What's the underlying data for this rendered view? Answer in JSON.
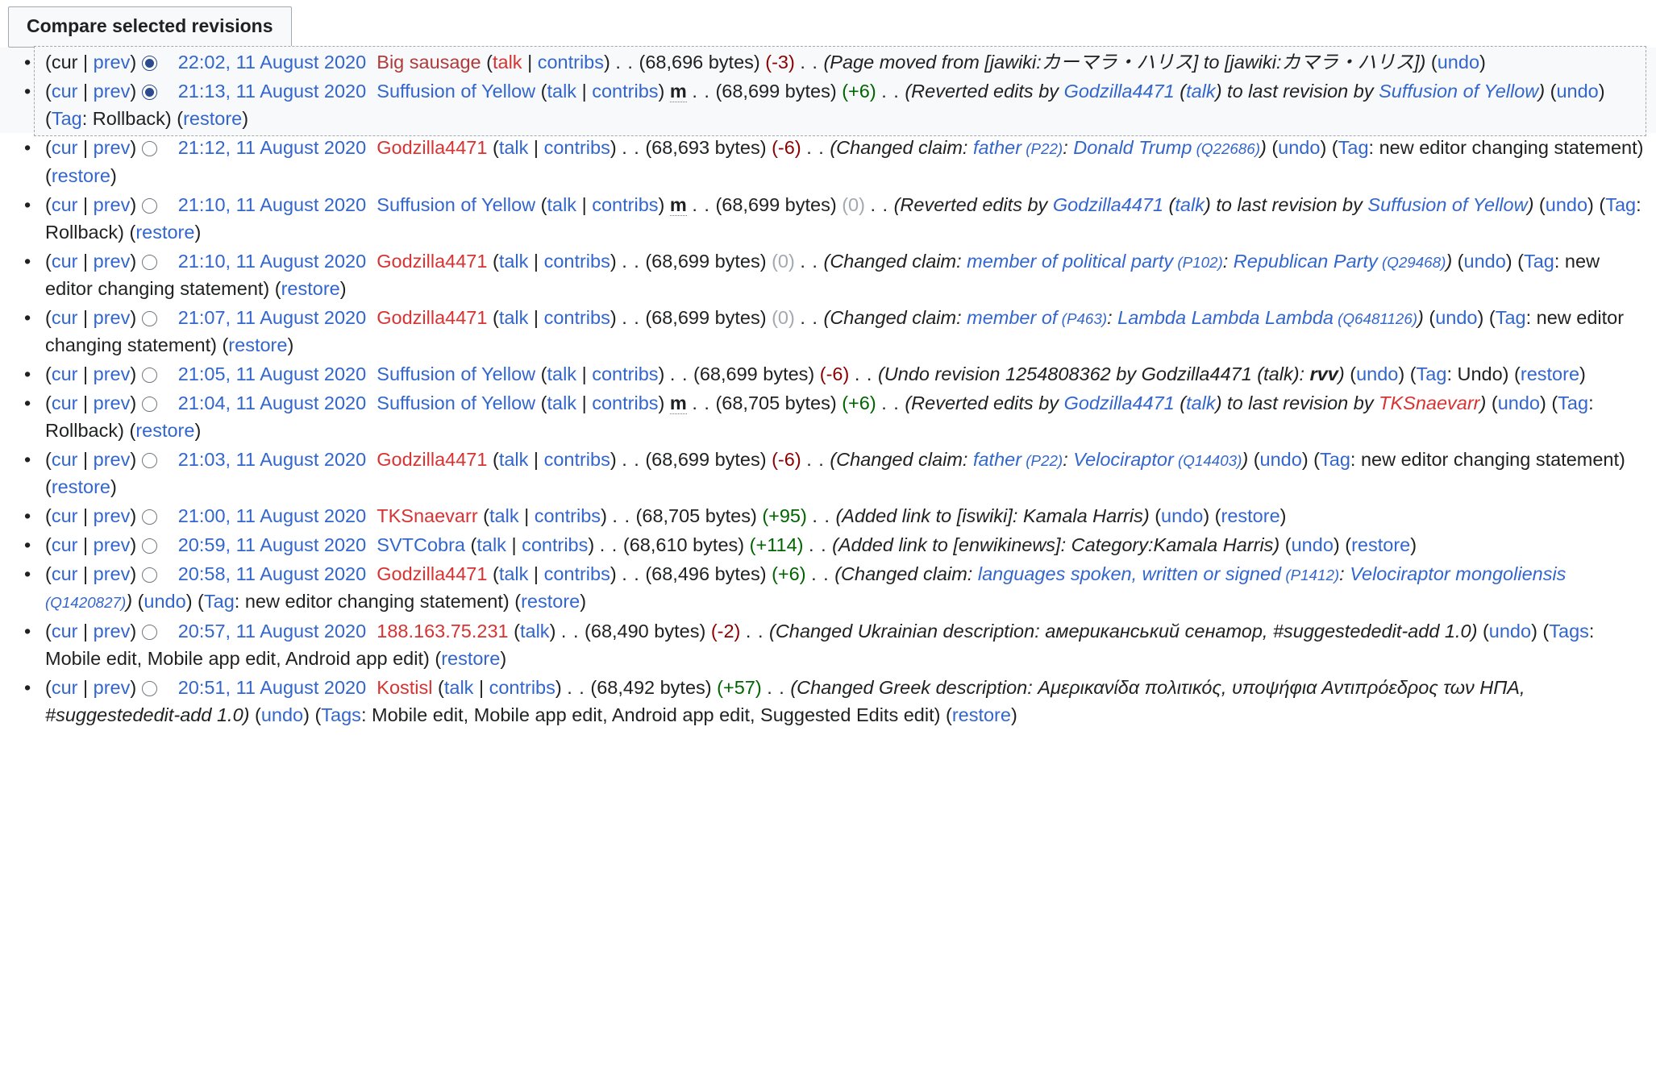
{
  "toolbar": {
    "compare_label": "Compare selected revisions"
  },
  "labels": {
    "cur": "cur",
    "prev": "prev",
    "pipe": "|",
    "talk": "talk",
    "contribs": "contribs",
    "undo": "undo",
    "restore": "restore",
    "minor": "m",
    "dots": ". .",
    "tag_word": "Tag",
    "tags_word": "Tags",
    "bytes_word": "bytes"
  },
  "colors": {
    "link": "#3366cc",
    "link_red": "#d73333",
    "link_red_visited": "#b03a3a",
    "diff_positive": "#006400",
    "diff_negative": "#8b0000",
    "diff_zero": "#a2a9b1",
    "comment": "#72777d",
    "selected_bg": "#f8f9fa",
    "border": "#a2a9b1"
  },
  "revisions": [
    {
      "selected": true,
      "radio": "on",
      "time": "22:02, 11 August 2020",
      "user": "Big sausage",
      "user_color": "red-visited",
      "minor": false,
      "size": "(68,696 bytes)",
      "delta": "(-3)",
      "delta_kind": "neg",
      "comment_prefix": "Page moved from [jawiki:",
      "comment_text": "(Page moved from [jawiki:カーマラ・ハリス] to [jawiki:カマラ・ハリス])",
      "has_undo": true,
      "tags": null,
      "has_restore": false
    },
    {
      "selected": true,
      "radio": "on",
      "time": "21:13, 11 August 2020",
      "user": "Suffusion of Yellow",
      "user_color": "blue",
      "minor": true,
      "size": "(68,699 bytes)",
      "delta": "(+6)",
      "delta_kind": "pos",
      "comment_text": "(Reverted edits by Godzilla4471 (talk) to last revision by Suffusion of Yellow)",
      "comment_parts": [
        {
          "t": "(Reverted edits by ",
          "k": "plain"
        },
        {
          "t": "Godzilla4471",
          "k": "link"
        },
        {
          "t": " (",
          "k": "plain"
        },
        {
          "t": "talk",
          "k": "link"
        },
        {
          "t": ") to last revision by ",
          "k": "plain"
        },
        {
          "t": "Suffusion of Yellow",
          "k": "link"
        },
        {
          "t": ")",
          "k": "plain"
        }
      ],
      "has_undo": true,
      "tags": "Rollback",
      "tag_label": "Tag",
      "has_restore": true
    },
    {
      "selected": false,
      "radio": "off",
      "time": "21:12, 11 August 2020",
      "user": "Godzilla4471",
      "user_color": "red",
      "minor": false,
      "size": "(68,693 bytes)",
      "delta": "(-6)",
      "delta_kind": "neg",
      "comment_parts": [
        {
          "t": "(Changed claim: ",
          "k": "plain"
        },
        {
          "t": "father",
          "k": "link"
        },
        {
          "t": " (P22)",
          "k": "link-small"
        },
        {
          "t": ": ",
          "k": "plain"
        },
        {
          "t": "Donald Trump",
          "k": "link"
        },
        {
          "t": " (Q22686)",
          "k": "link-small"
        },
        {
          "t": ")",
          "k": "plain"
        }
      ],
      "has_undo": true,
      "tags": "new editor changing statement",
      "tag_label": "Tag",
      "has_restore": true
    },
    {
      "selected": false,
      "radio": "off",
      "time": "21:10, 11 August 2020",
      "user": "Suffusion of Yellow",
      "user_color": "blue",
      "minor": true,
      "size": "(68,699 bytes)",
      "delta": "(0)",
      "delta_kind": "zero",
      "comment_parts": [
        {
          "t": "(Reverted edits by ",
          "k": "plain"
        },
        {
          "t": "Godzilla4471",
          "k": "link"
        },
        {
          "t": " (",
          "k": "plain"
        },
        {
          "t": "talk",
          "k": "link"
        },
        {
          "t": ") to last revision by ",
          "k": "plain"
        },
        {
          "t": "Suffusion of Yellow",
          "k": "link"
        },
        {
          "t": ")",
          "k": "plain"
        }
      ],
      "has_undo": true,
      "tags": "Rollback",
      "tag_label": "Tag",
      "has_restore": true
    },
    {
      "selected": false,
      "radio": "off",
      "time": "21:10, 11 August 2020",
      "user": "Godzilla4471",
      "user_color": "red",
      "minor": false,
      "size": "(68,699 bytes)",
      "delta": "(0)",
      "delta_kind": "zero",
      "comment_parts": [
        {
          "t": "(Changed claim: ",
          "k": "plain"
        },
        {
          "t": "member of political party",
          "k": "link"
        },
        {
          "t": " (P102)",
          "k": "link-small"
        },
        {
          "t": ": ",
          "k": "plain"
        },
        {
          "t": "Republican Party",
          "k": "link"
        },
        {
          "t": " (Q29468)",
          "k": "link-small"
        },
        {
          "t": ")",
          "k": "plain"
        }
      ],
      "has_undo": true,
      "tags": "new editor changing statement",
      "tag_label": "Tag",
      "has_restore": true
    },
    {
      "selected": false,
      "radio": "off",
      "time": "21:07, 11 August 2020",
      "user": "Godzilla4471",
      "user_color": "red",
      "minor": false,
      "size": "(68,699 bytes)",
      "delta": "(0)",
      "delta_kind": "zero",
      "comment_parts": [
        {
          "t": "(Changed claim: ",
          "k": "plain"
        },
        {
          "t": "member of",
          "k": "link"
        },
        {
          "t": " (P463)",
          "k": "link-small"
        },
        {
          "t": ": ",
          "k": "plain"
        },
        {
          "t": "Lambda Lambda Lambda",
          "k": "link"
        },
        {
          "t": " (Q6481126)",
          "k": "link-small"
        },
        {
          "t": ")",
          "k": "plain"
        }
      ],
      "has_undo": true,
      "tags": "new editor changing statement",
      "tag_label": "Tag",
      "has_restore": true
    },
    {
      "selected": false,
      "radio": "off",
      "time": "21:05, 11 August 2020",
      "user": "Suffusion of Yellow",
      "user_color": "blue",
      "minor": false,
      "size": "(68,699 bytes)",
      "delta": "(-6)",
      "delta_kind": "neg",
      "comment_parts": [
        {
          "t": "(Undo revision 1254808362 by Godzilla4471 (talk): ",
          "k": "plain"
        },
        {
          "t": "rvv",
          "k": "plain-bold-italic"
        },
        {
          "t": ")",
          "k": "plain"
        }
      ],
      "has_undo": true,
      "tags": "Undo",
      "tag_label": "Tag",
      "has_restore": true
    },
    {
      "selected": false,
      "radio": "off",
      "time": "21:04, 11 August 2020",
      "user": "Suffusion of Yellow",
      "user_color": "blue",
      "minor": true,
      "size": "(68,705 bytes)",
      "delta": "(+6)",
      "delta_kind": "pos",
      "comment_parts": [
        {
          "t": "(Reverted edits by ",
          "k": "plain"
        },
        {
          "t": "Godzilla4471",
          "k": "link"
        },
        {
          "t": " (",
          "k": "plain"
        },
        {
          "t": "talk",
          "k": "link"
        },
        {
          "t": ") to last revision by ",
          "k": "plain"
        },
        {
          "t": "TKSnaevarr",
          "k": "link-red"
        },
        {
          "t": ")",
          "k": "plain"
        }
      ],
      "has_undo": true,
      "tags": "Rollback",
      "tag_label": "Tag",
      "has_restore": true
    },
    {
      "selected": false,
      "radio": "off",
      "time": "21:03, 11 August 2020",
      "user": "Godzilla4471",
      "user_color": "red",
      "minor": false,
      "size": "(68,699 bytes)",
      "delta": "(-6)",
      "delta_kind": "neg",
      "comment_parts": [
        {
          "t": "(Changed claim: ",
          "k": "plain"
        },
        {
          "t": "father",
          "k": "link"
        },
        {
          "t": " (P22)",
          "k": "link-small"
        },
        {
          "t": ": ",
          "k": "plain"
        },
        {
          "t": "Velociraptor",
          "k": "link"
        },
        {
          "t": " (Q14403)",
          "k": "link-small"
        },
        {
          "t": ")",
          "k": "plain"
        }
      ],
      "has_undo": true,
      "tags": "new editor changing statement",
      "tag_label": "Tag",
      "has_restore": true
    },
    {
      "selected": false,
      "radio": "off",
      "time": "21:00, 11 August 2020",
      "user": "TKSnaevarr",
      "user_color": "red",
      "minor": false,
      "size": "(68,705 bytes)",
      "delta": "(+95)",
      "delta_kind": "pos",
      "comment_parts": [
        {
          "t": "(Added link to [iswiki]: ",
          "k": "plain"
        },
        {
          "t": "Kamala Harris",
          "k": "plain"
        },
        {
          "t": ")",
          "k": "plain"
        }
      ],
      "has_undo": true,
      "tags": null,
      "has_restore": true
    },
    {
      "selected": false,
      "radio": "off",
      "time": "20:59, 11 August 2020",
      "user": "SVTCobra",
      "user_color": "blue",
      "minor": false,
      "size": "(68,610 bytes)",
      "delta": "(+114)",
      "delta_kind": "pos",
      "comment_parts": [
        {
          "t": "(Added link to [enwikinews]: ",
          "k": "plain"
        },
        {
          "t": "Category:Kamala Harris",
          "k": "plain"
        },
        {
          "t": ")",
          "k": "plain"
        }
      ],
      "has_undo": true,
      "tags": null,
      "has_restore": true
    },
    {
      "selected": false,
      "radio": "off",
      "time": "20:58, 11 August 2020",
      "user": "Godzilla4471",
      "user_color": "red",
      "minor": false,
      "size": "(68,496 bytes)",
      "delta": "(+6)",
      "delta_kind": "pos",
      "comment_parts": [
        {
          "t": "(Changed claim: ",
          "k": "plain"
        },
        {
          "t": "languages spoken, written or signed",
          "k": "link"
        },
        {
          "t": " (P1412)",
          "k": "link-small"
        },
        {
          "t": ": ",
          "k": "plain"
        },
        {
          "t": "Velociraptor mongoliensis",
          "k": "link"
        },
        {
          "t": " (Q1420827)",
          "k": "link-small"
        },
        {
          "t": ")",
          "k": "plain"
        }
      ],
      "has_undo": true,
      "tags": "new editor changing statement",
      "tag_label": "Tag",
      "has_restore": true
    },
    {
      "selected": false,
      "radio": "off",
      "time": "20:57, 11 August 2020",
      "user": "188.163.75.231",
      "user_color": "red",
      "minor": false,
      "user_links": [
        "talk"
      ],
      "size": "(68,490 bytes)",
      "delta": "(-2)",
      "delta_kind": "neg",
      "comment_parts": [
        {
          "t": "(Changed Ukrainian description: ",
          "k": "plain"
        },
        {
          "t": "американський сенатор, #suggestededit-add 1.0",
          "k": "plain"
        },
        {
          "t": ")",
          "k": "plain"
        }
      ],
      "has_undo": true,
      "tags": "Mobile edit, Mobile app edit, Android app edit",
      "tag_label": "Tags",
      "has_restore": true
    },
    {
      "selected": false,
      "radio": "off",
      "time": "20:51, 11 August 2020",
      "user": "Kostisl",
      "user_color": "red",
      "minor": false,
      "size": "(68,492 bytes)",
      "delta": "(+57)",
      "delta_kind": "pos",
      "comment_parts": [
        {
          "t": "(Changed Greek description: ",
          "k": "plain"
        },
        {
          "t": "Αμερικανίδα πολιτικός, υποψήφια Αντιπρόεδρος των ΗΠΑ, #suggestededit-add 1.0",
          "k": "plain"
        },
        {
          "t": ")",
          "k": "plain"
        }
      ],
      "has_undo": true,
      "tags": "Mobile edit, Mobile app edit, Android app edit, Suggested Edits edit",
      "tag_label": "Tags",
      "has_restore": true
    }
  ]
}
